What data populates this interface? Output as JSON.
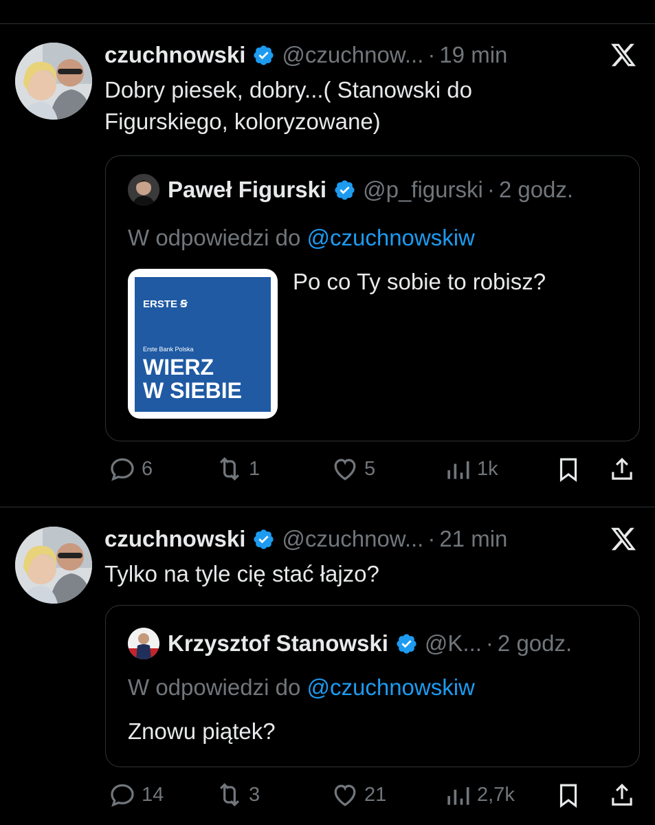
{
  "tweets": [
    {
      "author_name": "czuchnowski",
      "author_handle": "@czuchnow...",
      "time": "19 min",
      "text": "Dobry piesek, dobry...( Stanowski do Figurskiego, koloryzowane)",
      "quote": {
        "name": "Paweł Figurski",
        "handle": "@p_figurski",
        "time": "2 godz.",
        "reply_prefix": "W odpowiedzi do",
        "reply_mention": "@czuchnowskiw",
        "text": "Po co Ty sobie to robisz?",
        "image": {
          "logo": "ERSTE Ꞩ",
          "small": "Erste Bank Polska",
          "big_line1": "WIERZ",
          "big_line2": "W SIEBIE"
        }
      },
      "stats": {
        "replies": "6",
        "reposts": "1",
        "likes": "5",
        "views": "1k"
      }
    },
    {
      "author_name": "czuchnowski",
      "author_handle": "@czuchnow...",
      "time": "21 min",
      "text": "Tylko na tyle cię stać łajzo?",
      "quote": {
        "name": "Krzysztof Stanowski",
        "handle": "@K...",
        "time": "2 godz.",
        "reply_prefix": "W odpowiedzi do",
        "reply_mention": "@czuchnowskiw",
        "text": "Znowu piątek?"
      },
      "stats": {
        "replies": "14",
        "reposts": "3",
        "likes": "21",
        "views": "2,7k"
      }
    }
  ],
  "colors": {
    "background": "#000000",
    "text": "#e7e9ea",
    "muted": "#71767b",
    "link": "#1d9bf0",
    "border": "#2f3336"
  },
  "icons": [
    "x-logo-icon",
    "verified-badge-icon",
    "reply-icon",
    "repost-icon",
    "like-icon",
    "views-icon",
    "bookmark-icon",
    "share-icon"
  ]
}
